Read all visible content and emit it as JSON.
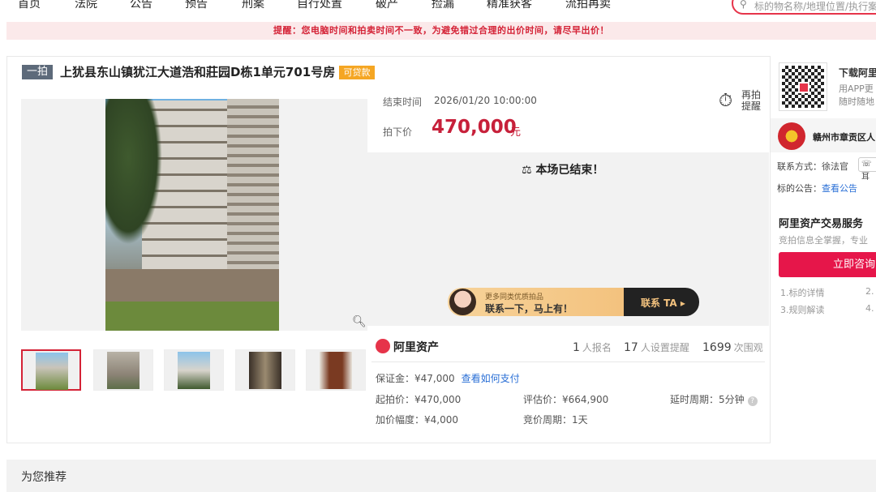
{
  "nav": {
    "items": [
      "首页",
      "法院",
      "公告",
      "预告",
      "刑案",
      "自行处置",
      "破产",
      "捡漏",
      "精准获客",
      "流拍再卖"
    ],
    "search_placeholder": "标的物名称/地理位置/执行案"
  },
  "alert": "提醒：您电脑时间和拍卖时间不一致，为避免错过合理的出价时间，请尽早出价！",
  "listing": {
    "round_badge": "一拍",
    "title": "上犹县东山镇犹江大道浩和莊园D栋1单元701号房",
    "loan_badge": "可贷款"
  },
  "auction": {
    "end_time_label": "结束时间",
    "end_time": "2026/01/20 10:00:00",
    "remind_label": "再拍提醒",
    "price_label": "拍下价",
    "price": "470,000",
    "price_unit": "元",
    "end_message": "本场已结束！"
  },
  "banner": {
    "line1": "更多同类优质拍品",
    "line2": "联系一下，马上有！",
    "cta": "联系 TA ▸"
  },
  "platform": {
    "logo": "阿里资产",
    "signups_count": "1",
    "signups_label": "人报名",
    "reminders_count": "17",
    "reminders_label": "人设置提醒",
    "views_count": "1699",
    "views_label": "次围观"
  },
  "terms": {
    "deposit": "保证金：¥47,000",
    "deposit_link": "查看如何支付",
    "start_price": "起拍价：¥470,000",
    "appraisal": "评估价：¥664,900",
    "delay_period": "延时周期：5分钟",
    "increment": "加价幅度：¥4,000",
    "bid_period": "竞价周期：1天"
  },
  "sidebar": {
    "app_title": "下载阿里",
    "app_line1": "用APP更",
    "app_line2": "随时随地",
    "court": "赣州市章贡区人",
    "contact": "联系方式：徐法官",
    "phone_btn": "☏ 耳",
    "notice_label": "标的公告：",
    "notice_link": "查看公告",
    "service_title": "阿里资产交易服务",
    "service_sub": "竞拍信息全掌握，专业",
    "consult": "立即咨询",
    "items": [
      "1.标的详情",
      "2.",
      "3.规则解读",
      "4."
    ]
  },
  "recommend": "为您推荐"
}
